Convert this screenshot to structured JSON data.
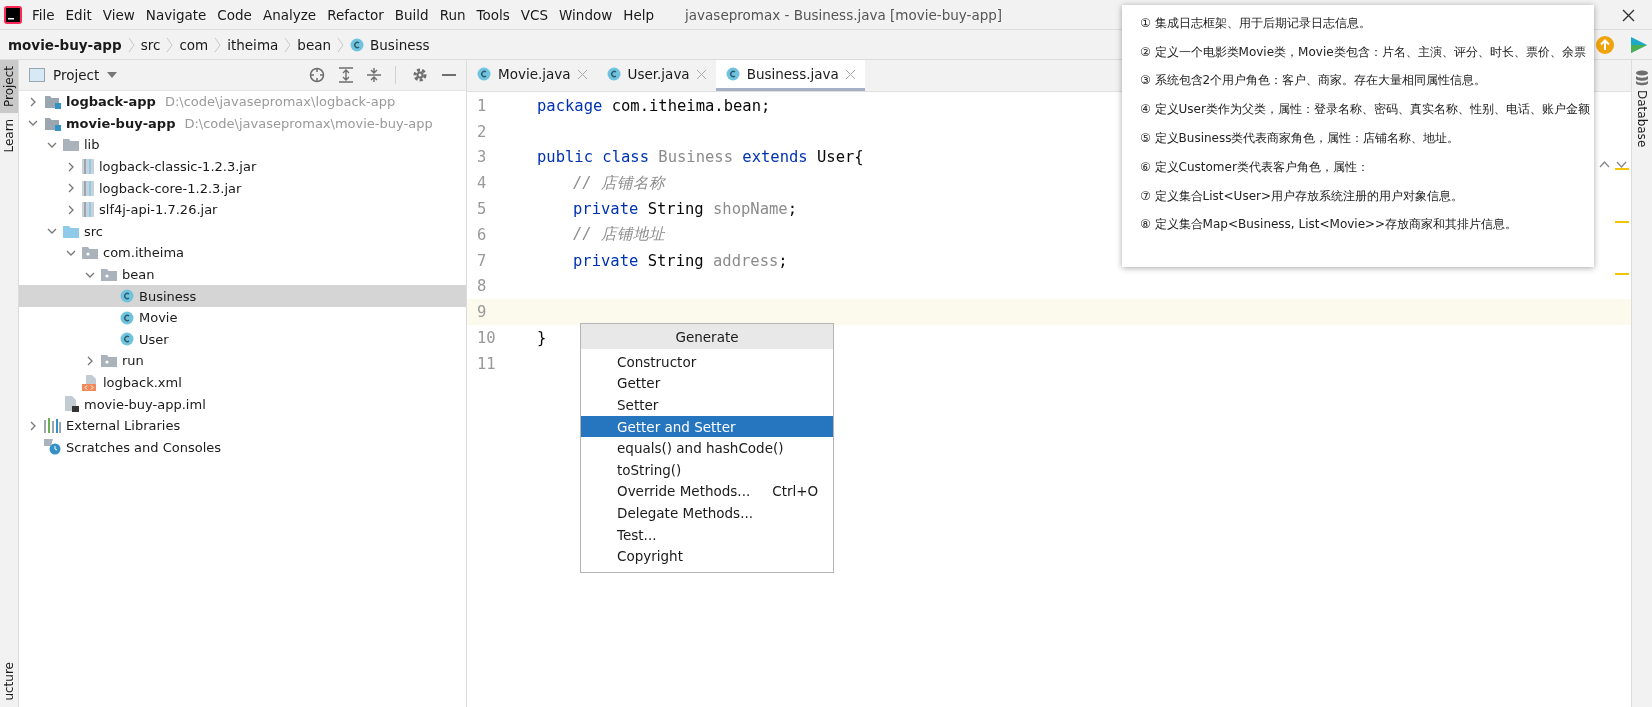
{
  "menu": [
    "File",
    "Edit",
    "View",
    "Navigate",
    "Code",
    "Analyze",
    "Refactor",
    "Build",
    "Run",
    "Tools",
    "VCS",
    "Window",
    "Help"
  ],
  "window_title": "javasepromax - Business.java [movie-buy-app]",
  "breadcrumb": [
    {
      "label": "movie-buy-app",
      "kind": "module"
    },
    {
      "label": "src",
      "kind": "folder"
    },
    {
      "label": "com",
      "kind": "folder"
    },
    {
      "label": "itheima",
      "kind": "folder"
    },
    {
      "label": "bean",
      "kind": "folder"
    },
    {
      "label": "Business",
      "kind": "class"
    }
  ],
  "left_stripe": [
    {
      "label": "Project",
      "selected": true
    },
    {
      "label": "Learn",
      "selected": false
    }
  ],
  "left_stripe_bottom": "ucture",
  "project_panel": {
    "title": "Project",
    "tree": [
      {
        "label": "logback-app",
        "kind": "module",
        "path": "D:\\code\\javasepromax\\logback-app",
        "expanded": false,
        "selected": false
      },
      {
        "label": "movie-buy-app",
        "kind": "module",
        "path": "D:\\code\\javasepromax\\movie-buy-app",
        "expanded": true,
        "selected": false,
        "children": [
          {
            "label": "lib",
            "kind": "folder",
            "expanded": true,
            "selected": false,
            "children": [
              {
                "label": "logback-classic-1.2.3.jar",
                "kind": "jar",
                "expanded": false,
                "selected": false
              },
              {
                "label": "logback-core-1.2.3.jar",
                "kind": "jar",
                "expanded": false,
                "selected": false
              },
              {
                "label": "slf4j-api-1.7.26.jar",
                "kind": "jar",
                "expanded": false,
                "selected": false
              }
            ]
          },
          {
            "label": "src",
            "kind": "source",
            "expanded": true,
            "selected": false,
            "children": [
              {
                "label": "com.itheima",
                "kind": "package",
                "expanded": true,
                "selected": false,
                "children": [
                  {
                    "label": "bean",
                    "kind": "package",
                    "expanded": true,
                    "selected": false,
                    "children": [
                      {
                        "label": "Business",
                        "kind": "class",
                        "selected": true
                      },
                      {
                        "label": "Movie",
                        "kind": "class",
                        "selected": false
                      },
                      {
                        "label": "User",
                        "kind": "class",
                        "selected": false
                      }
                    ]
                  },
                  {
                    "label": "run",
                    "kind": "package",
                    "expanded": false,
                    "selected": false
                  }
                ]
              },
              {
                "label": "logback.xml",
                "kind": "xml",
                "selected": false
              }
            ]
          },
          {
            "label": "movie-buy-app.iml",
            "kind": "iml",
            "selected": false
          }
        ]
      },
      {
        "label": "External Libraries",
        "kind": "libraries",
        "expanded": false,
        "selected": false
      },
      {
        "label": "Scratches and Consoles",
        "kind": "scratches",
        "selected": false
      }
    ]
  },
  "editor": {
    "tabs": [
      {
        "label": "Movie.java",
        "selected": false
      },
      {
        "label": "User.java",
        "selected": false
      },
      {
        "label": "Business.java",
        "selected": true
      }
    ],
    "lines": [
      {
        "number": "1",
        "indented": false,
        "current": false,
        "tokens": [
          {
            "text": "package ",
            "kind": "keyword"
          },
          {
            "text": "com.itheima.bean;",
            "kind": "plain"
          }
        ]
      },
      {
        "number": "2",
        "current": false
      },
      {
        "number": "3",
        "indented": false,
        "current": false,
        "tokens": [
          {
            "text": "public ",
            "kind": "keyword"
          },
          {
            "text": "class ",
            "kind": "keyword"
          },
          {
            "text": "Business ",
            "kind": "muted"
          },
          {
            "text": "extends ",
            "kind": "keyword"
          },
          {
            "text": "User{",
            "kind": "plain"
          }
        ]
      },
      {
        "number": "4",
        "indented": true,
        "current": false,
        "tokens": [
          {
            "text": "// 店铺名称",
            "kind": "comment"
          }
        ]
      },
      {
        "number": "5",
        "indented": true,
        "current": false,
        "tokens": [
          {
            "text": "private ",
            "kind": "keyword"
          },
          {
            "text": "String ",
            "kind": "plain"
          },
          {
            "text": "shopName",
            "kind": "muted"
          },
          {
            "text": ";",
            "kind": "plain"
          }
        ]
      },
      {
        "number": "6",
        "indented": true,
        "current": false,
        "tokens": [
          {
            "text": "// 店铺地址",
            "kind": "comment"
          }
        ]
      },
      {
        "number": "7",
        "indented": true,
        "current": false,
        "tokens": [
          {
            "text": "private ",
            "kind": "keyword"
          },
          {
            "text": "String ",
            "kind": "plain"
          },
          {
            "text": "address",
            "kind": "muted"
          },
          {
            "text": ";",
            "kind": "plain"
          }
        ]
      },
      {
        "number": "8",
        "current": false
      },
      {
        "number": "9",
        "current": true
      },
      {
        "number": "10",
        "indented": false,
        "current": false,
        "tokens": [
          {
            "text": "}",
            "kind": "plain"
          }
        ]
      },
      {
        "number": "11",
        "current": false
      }
    ]
  },
  "generate_popup": {
    "title": "Generate",
    "items": [
      {
        "label": "Constructor",
        "selected": false
      },
      {
        "label": "Getter",
        "selected": false
      },
      {
        "label": "Setter",
        "selected": false
      },
      {
        "label": "Getter and Setter",
        "selected": true
      },
      {
        "label": "equals() and hashCode()",
        "selected": false
      },
      {
        "label": "toString()",
        "selected": false
      },
      {
        "label": "Override Methods...",
        "shortcut": "Ctrl+O",
        "selected": false
      },
      {
        "label": "Delegate Methods...",
        "selected": false
      },
      {
        "label": "Test...",
        "selected": false
      },
      {
        "label": "Copyright",
        "selected": false
      }
    ]
  },
  "notes": [
    "① 集成日志框架、用于后期记录日志信息。",
    "② 定义一个电影类Movie类，Movie类包含：片名、主演、评分、时长、票价、余票",
    "③ 系统包含2个用户角色：客户、商家。存在大量相同属性信息。",
    "④ 定义User类作为父类，属性：登录名称、密码、真实名称、性别、电话、账户金额",
    "⑤ 定义Business类代表商家角色，属性：店铺名称、地址。",
    "⑥ 定义Customer类代表客户角色，属性：",
    "⑦ 定义集合List<User>用户存放系统注册的用户对象信息。",
    "⑧ 定义集合Map<Business, List<Movie>>存放商家和其排片信息。"
  ],
  "right_stripe": {
    "label": "Database"
  }
}
